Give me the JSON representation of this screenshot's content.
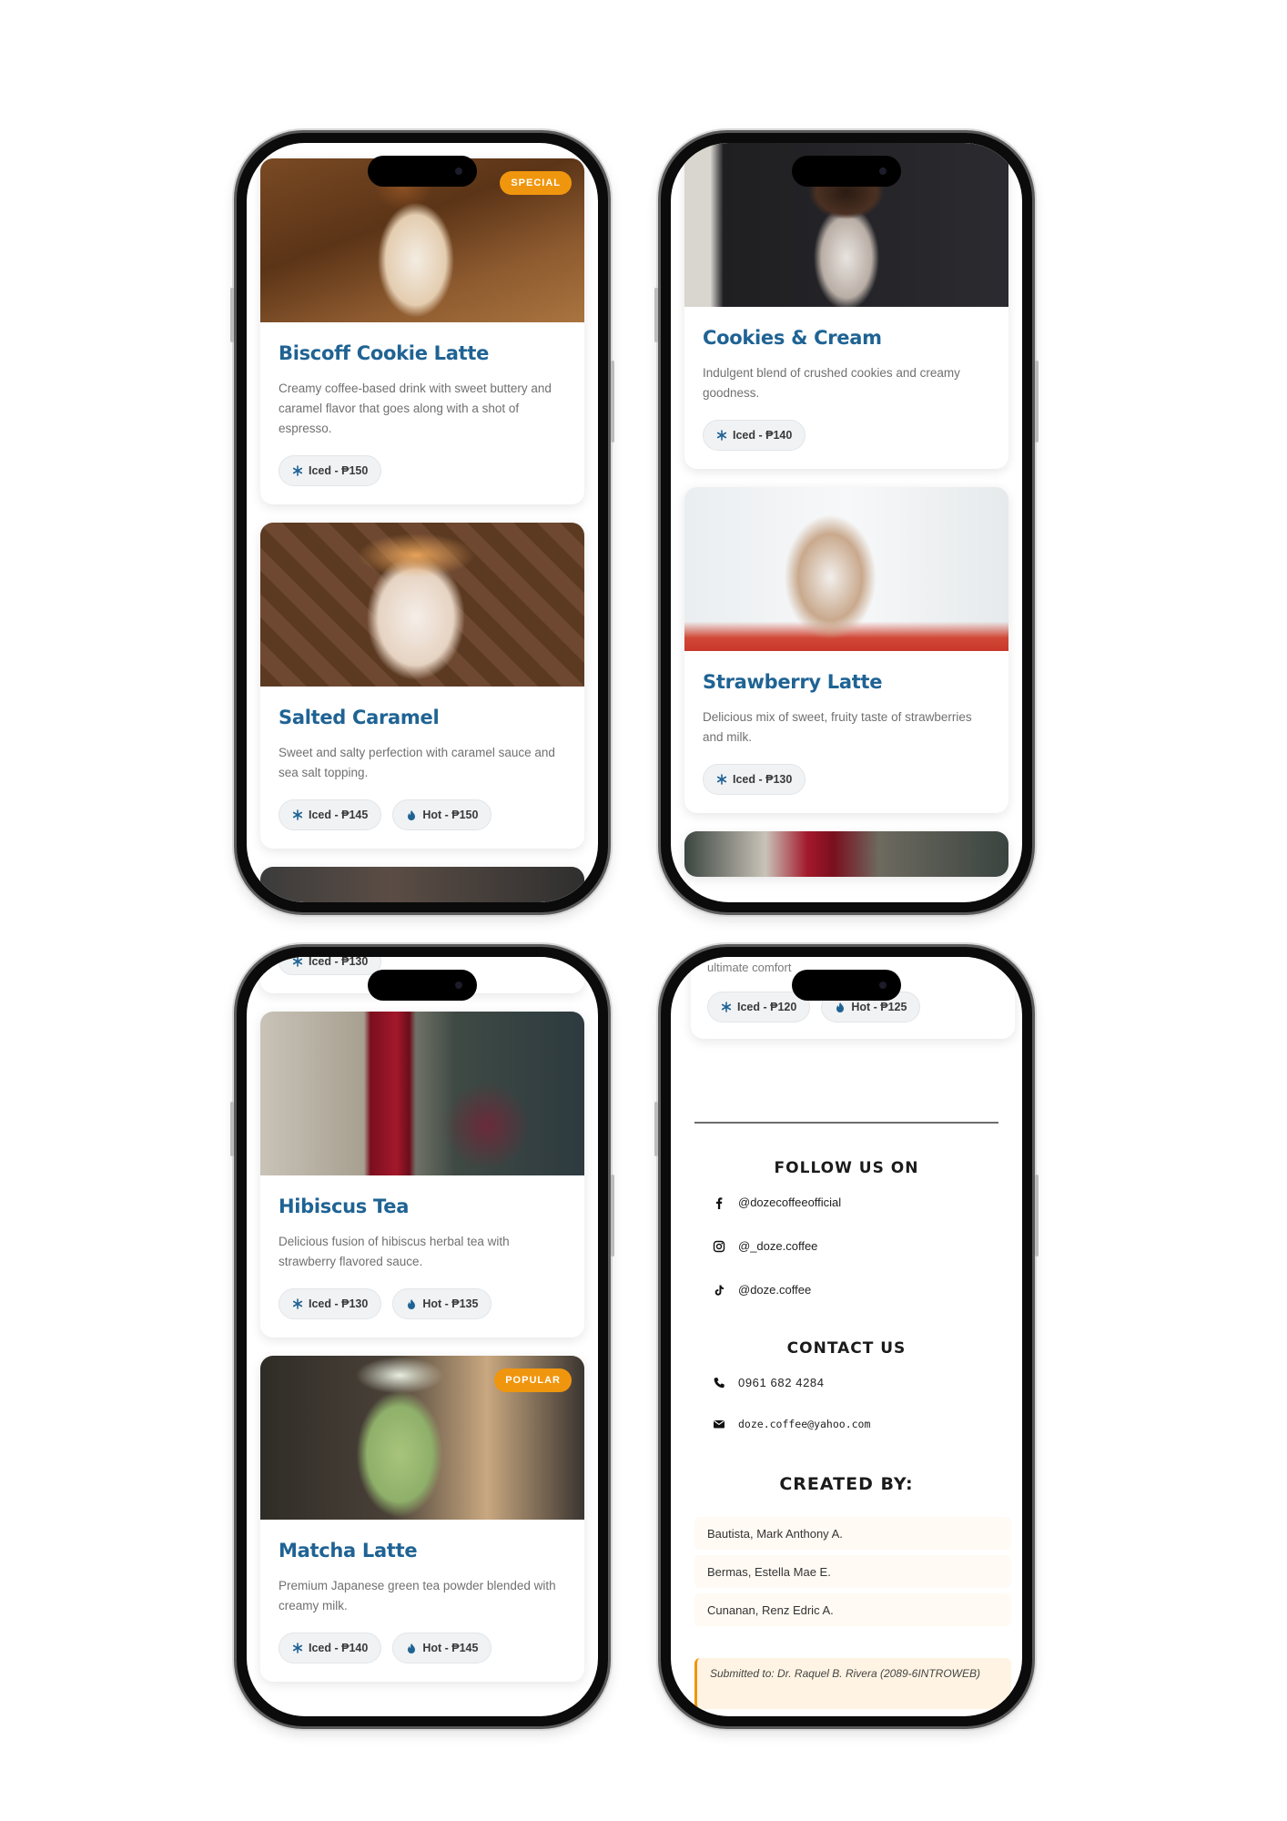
{
  "menu": {
    "biscoff": {
      "title": "Biscoff Cookie Latte",
      "desc": "Creamy coffee-based drink with sweet buttery and caramel flavor that goes along with a shot of espresso.",
      "badge": "SPECIAL",
      "chips": [
        "Iced - ₱150"
      ]
    },
    "salted": {
      "title": "Salted Caramel",
      "desc": "Sweet and salty perfection with caramel sauce and sea salt topping.",
      "chips": [
        "Iced - ₱145",
        "Hot - ₱150"
      ]
    },
    "cookies": {
      "title": "Cookies & Cream",
      "desc": "Indulgent blend of crushed cookies and creamy goodness.",
      "chips": [
        "Iced - ₱140"
      ]
    },
    "strawberry": {
      "title": "Strawberry Latte",
      "desc": "Delicious mix of sweet, fruity taste of strawberries and milk.",
      "chips": [
        "Iced - ₱130"
      ]
    },
    "hibiscus": {
      "title": "Hibiscus Tea",
      "desc": "Delicious fusion of hibiscus herbal tea with strawberry flavored sauce.",
      "chips": [
        "Iced - ₱130",
        "Hot - ₱135"
      ]
    },
    "matcha": {
      "title": "Matcha Latte",
      "desc": "Premium Japanese green tea powder blended with creamy milk.",
      "badge": "POPULAR",
      "chips": [
        "Iced - ₱140",
        "Hot - ₱145"
      ]
    }
  },
  "partial": {
    "prev_chip": "Iced - ₱130",
    "comfort_text": "ultimate comfort",
    "comfort_chips": [
      "Iced - ₱120",
      "Hot - ₱125"
    ]
  },
  "footer": {
    "follow_heading": "FOLLOW US ON",
    "facebook": "@dozecoffeeofficial",
    "instagram": "@_doze.coffee",
    "tiktok": "@doze.coffee",
    "contact_heading": "CONTACT US",
    "phone": "0961 682 4284",
    "email": "doze.coffee@yahoo.com",
    "created_heading": "CREATED BY:",
    "creators": [
      "Bautista, Mark Anthony A.",
      "Bermas, Estella Mae E.",
      "Cunanan, Renz Edric A."
    ],
    "submitted": "Submitted to: Dr. Raquel B. Rivera (2089-6INTROWEB)"
  },
  "icons": {
    "iced": "snowflake-icon",
    "hot": "flame-icon",
    "facebook": "facebook-icon",
    "instagram": "instagram-icon",
    "tiktok": "tiktok-icon",
    "phone": "phone-icon",
    "email": "envelope-icon"
  },
  "colors": {
    "title_blue": "#1f6394",
    "badge_orange": "#f0960e"
  }
}
